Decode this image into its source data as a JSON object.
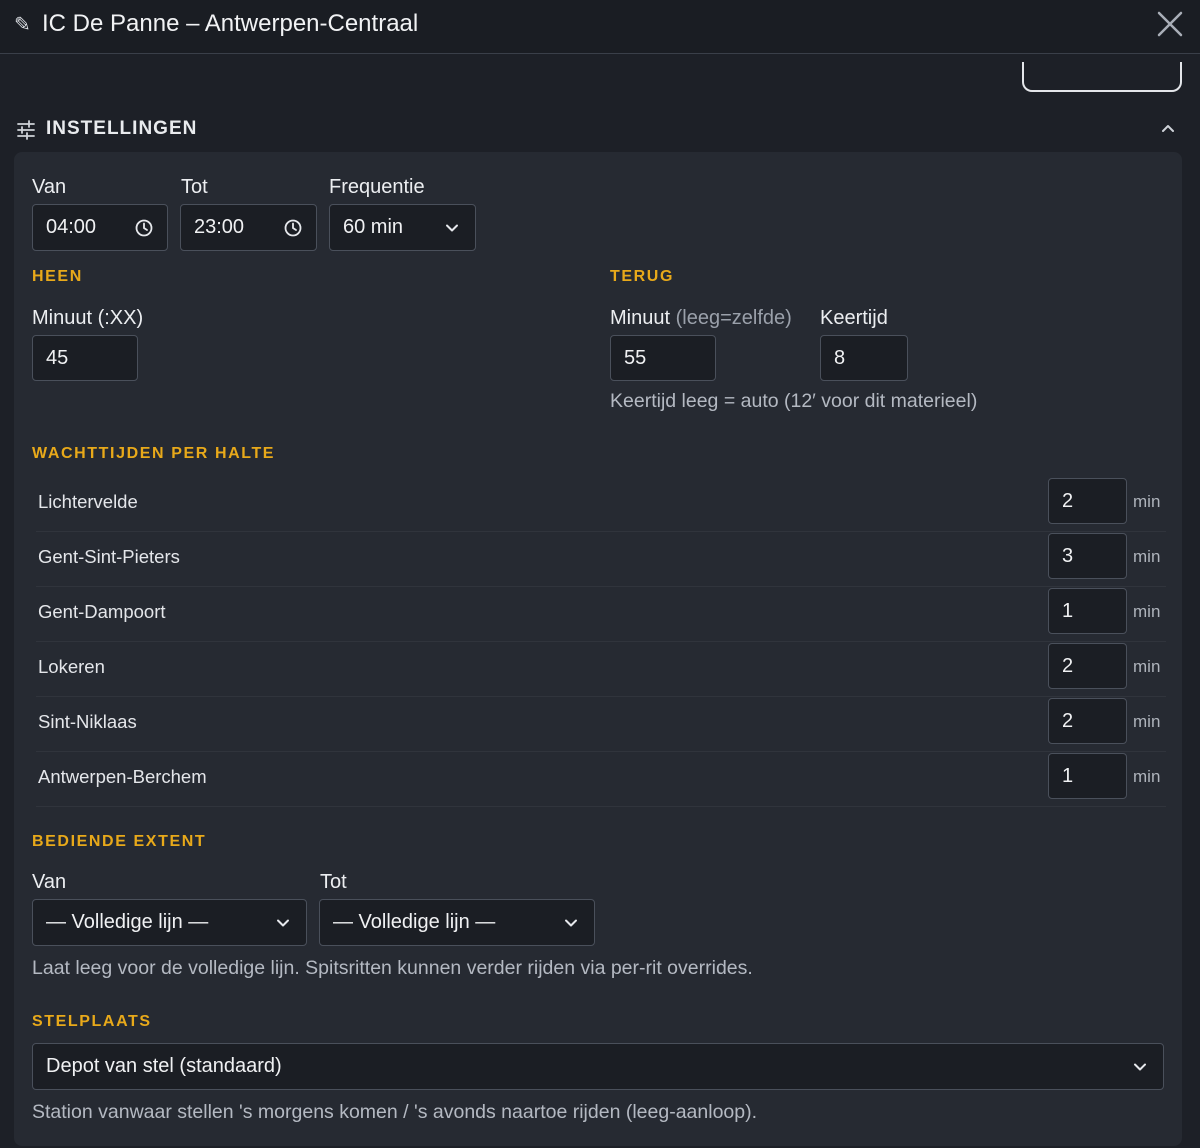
{
  "window": {
    "title_icon": "pencil-icon",
    "title": "IC De Panne – Antwerpen-Centraal",
    "close_icon": "close-icon"
  },
  "section": {
    "icon": "sliders-icon",
    "title": "INSTELLINGEN",
    "chevron": "chevron-up-icon"
  },
  "schedule": {
    "van_label": "Van",
    "van_value": "04:00",
    "tot_label": "Tot",
    "tot_value": "23:00",
    "freq_label": "Frequentie",
    "freq_value": "60 min"
  },
  "heen": {
    "heading": "HEEN",
    "minute_label": "Minuut (:XX)",
    "minute_value": "45"
  },
  "terug": {
    "heading": "TERUG",
    "minute_label": "Minuut",
    "minute_sub": "(leeg=zelfde)",
    "minute_value": "55",
    "keertijd_label": "Keertijd",
    "keertijd_value": "8",
    "hint": "Keertijd leeg = auto (12′ voor dit materieel)"
  },
  "wachttijden": {
    "heading": "WACHTTIJDEN PER HALTE",
    "unit": "min",
    "stops": [
      {
        "name": "Lichtervelde",
        "value": "2"
      },
      {
        "name": "Gent-Sint-Pieters",
        "value": "3"
      },
      {
        "name": "Gent-Dampoort",
        "value": "1"
      },
      {
        "name": "Lokeren",
        "value": "2"
      },
      {
        "name": "Sint-Niklaas",
        "value": "2"
      },
      {
        "name": "Antwerpen-Berchem",
        "value": "1"
      }
    ]
  },
  "extent": {
    "heading": "BEDIENDE EXTENT",
    "van_label": "Van",
    "van_value": "— Volledige lijn —",
    "tot_label": "Tot",
    "tot_value": "— Volledige lijn —",
    "hint": "Laat leeg voor de volledige lijn. Spitsritten kunnen verder rijden via per-rit overrides."
  },
  "stelplaats": {
    "heading": "STELPLAATS",
    "value": "Depot van stel (standaard)",
    "hint": "Station vanwaar stellen 's morgens komen / 's avonds naartoe rijden (leeg-aanloop)."
  },
  "colors": {
    "accent": "#e8a91a",
    "panel": "#262a32",
    "background": "#1d2027"
  }
}
